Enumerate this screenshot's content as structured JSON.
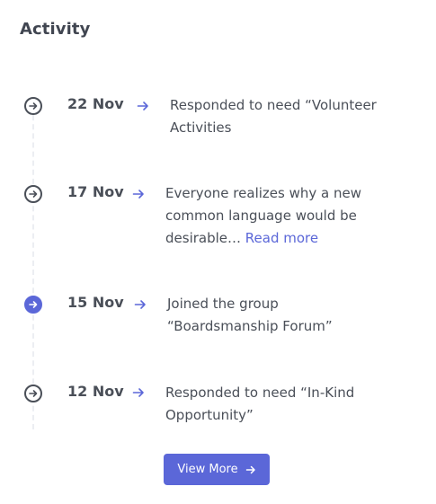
{
  "card": {
    "title": "Activity"
  },
  "colors": {
    "accent": "#5b67d8",
    "text": "#4a4f58",
    "timeline_line": "#eceef2"
  },
  "activities": [
    {
      "date": "22 Nov",
      "icon": "arrow-circle-right-icon",
      "active": false,
      "text_lines": [
        "Responded to need “Volunteer",
        "Activities"
      ]
    },
    {
      "date": "17 Nov",
      "icon": "arrow-circle-right-icon",
      "active": false,
      "text_lines": [
        "Everyone realizes why a new",
        "common language would be",
        "desirable…"
      ],
      "link": "Read more"
    },
    {
      "date": "15 Nov",
      "icon": "arrow-circle-right-icon",
      "active": true,
      "text_lines": [
        "Joined the group",
        "“Boardsmanship Forum”"
      ]
    },
    {
      "date": "12 Nov",
      "icon": "arrow-circle-right-icon",
      "active": false,
      "text_lines": [
        "Responded to need “In-Kind",
        "Opportunity”"
      ]
    }
  ],
  "view_more": {
    "label": "View More",
    "icon": "arrow-right-icon"
  }
}
